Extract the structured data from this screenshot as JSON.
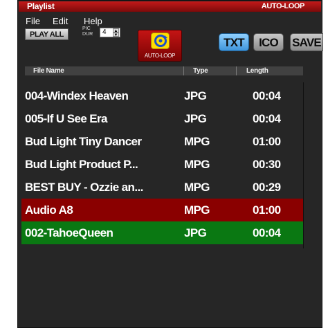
{
  "title": "Playlist",
  "mode_label": "AUTO-LOOP",
  "menu": {
    "file": "File",
    "edit": "Edit",
    "help": "Help"
  },
  "controls": {
    "play_all": "PLAY ALL",
    "pic_label": "PIC",
    "dur_label": "DUR",
    "duration_value": "4",
    "autoloop_label": "AUTO-LOOP",
    "txt": "TXT",
    "ico": "ICO",
    "save": "SAVE"
  },
  "columns": {
    "name": "File Name",
    "type": "Type",
    "length": "Length"
  },
  "rows": [
    {
      "name": "004-Windex Heaven",
      "type": "JPG",
      "length": "00:04",
      "state": "normal"
    },
    {
      "name": "005-If U See Era",
      "type": "JPG",
      "length": "00:04",
      "state": "normal"
    },
    {
      "name": "Bud Light Tiny Dancer",
      "type": "MPG",
      "length": "01:00",
      "state": "normal"
    },
    {
      "name": "Bud Light Product P...",
      "type": "MPG",
      "length": "00:30",
      "state": "normal"
    },
    {
      "name": "BEST BUY - Ozzie an...",
      "type": "MPG",
      "length": "00:29",
      "state": "normal"
    },
    {
      "name": "Audio A8",
      "type": "MPG",
      "length": "01:00",
      "state": "red"
    },
    {
      "name": "002-TahoeQueen",
      "type": "JPG",
      "length": "00:04",
      "state": "green"
    }
  ],
  "colors": {
    "title_red": "#c41a1a",
    "selected_red": "#8a0000",
    "playing_green": "#0a7812",
    "txt_blue": "#3f95db",
    "autoloop_yellow": "#ffdd00"
  }
}
